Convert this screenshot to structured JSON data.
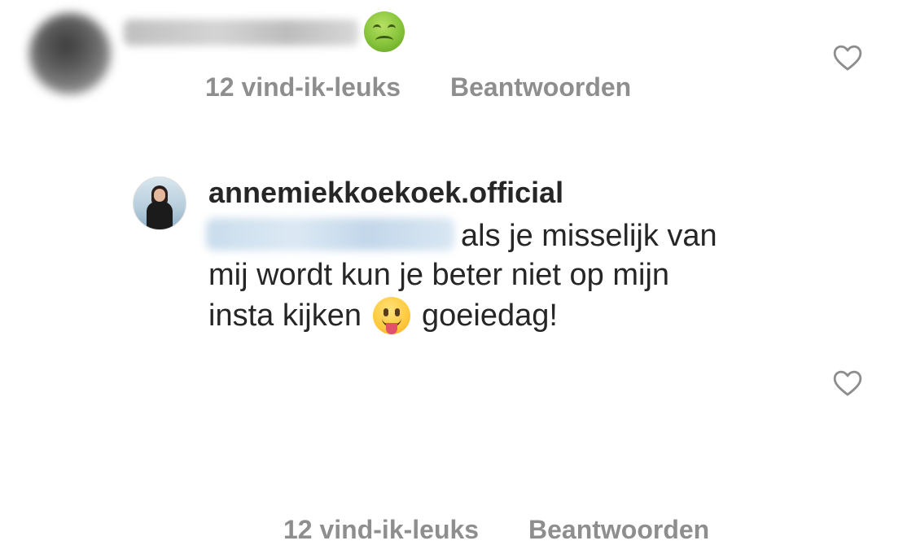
{
  "comments": [
    {
      "likes_text": "12 vind-ik-leuks",
      "reply_label": "Beantwoorden",
      "reaction_emoji": "nauseated-face-emoji",
      "like_icon": "heart-outline-icon"
    },
    {
      "username": "annemiekkoekoek.official",
      "line1": "als je misselijk van",
      "line2": "mij wordt kun je beter niet op mijn",
      "line3_start": "insta kijken",
      "line3_end": "goeiedag!",
      "inline_emoji": "tongue-out-emoji",
      "likes_text": "12 vind-ik-leuks",
      "reply_label": "Beantwoorden",
      "like_icon": "heart-outline-icon"
    }
  ],
  "colors": {
    "primary_text": "#262626",
    "secondary_text": "#8e8e8e",
    "background": "#ffffff"
  }
}
